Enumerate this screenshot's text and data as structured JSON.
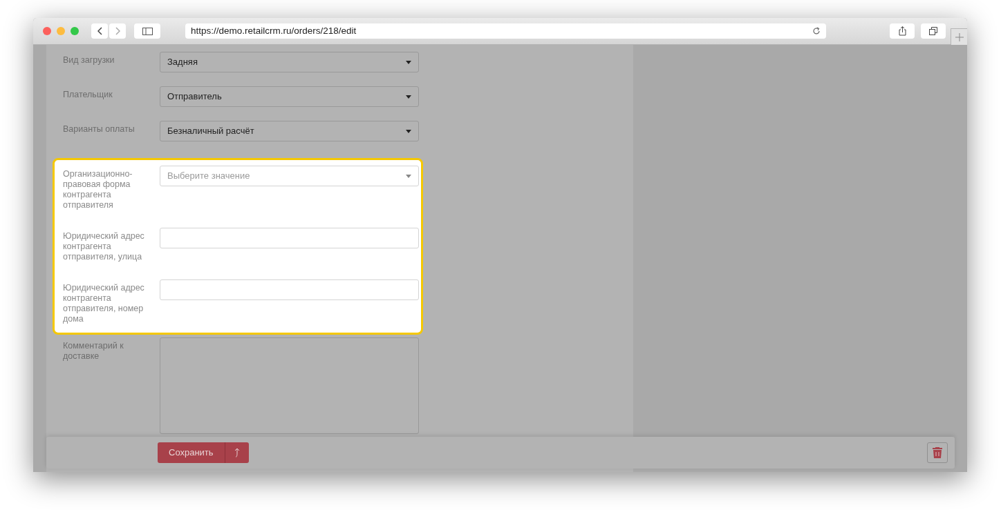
{
  "browser": {
    "url": "https://demo.retailcrm.ru/orders/218/edit"
  },
  "sections": [
    {
      "highlighted": false,
      "fields": [
        {
          "kind": "select",
          "label": "Вид загрузки",
          "value": "Задняя"
        },
        {
          "kind": "select",
          "label": "Плательщик",
          "value": "Отправитель"
        },
        {
          "kind": "select",
          "label": "Варианты оплаты",
          "value": "Безналичный расчёт"
        }
      ]
    },
    {
      "highlighted": true,
      "fields": [
        {
          "kind": "select",
          "label": "Организационно-правовая форма контрагента отправителя",
          "placeholder": "Выберите значение"
        },
        {
          "kind": "text",
          "label": "Юридический адрес контрагента отправителя, улица"
        },
        {
          "kind": "text",
          "label": "Юридический адрес контрагента отправителя, номер дома"
        }
      ]
    },
    {
      "highlighted": false,
      "fields": [
        {
          "kind": "textarea",
          "label": "Комментарий к доставке"
        }
      ]
    }
  ],
  "footer": {
    "save_button": "Сохранить"
  }
}
